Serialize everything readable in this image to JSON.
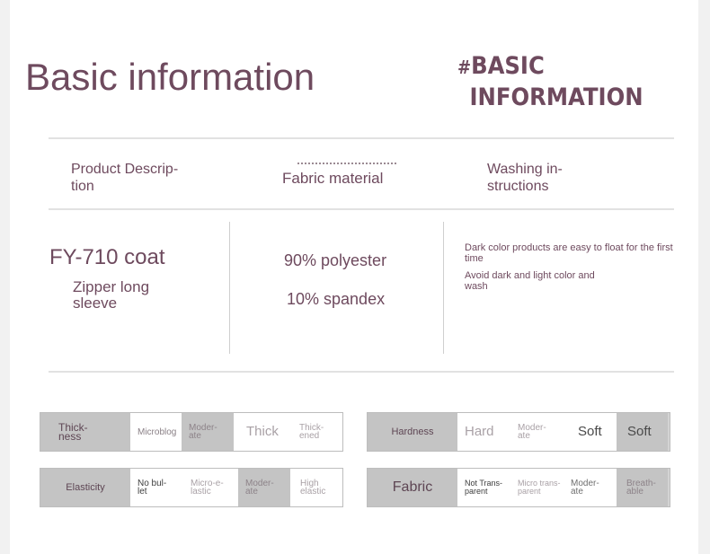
{
  "titles": {
    "left": "Basic information",
    "right_hash": "#",
    "right_line1": "BASIC",
    "right_line2": "INFORMATION"
  },
  "headers": {
    "product": [
      "Product Descrip-",
      "tion"
    ],
    "fabric": "Fabric material",
    "washing": [
      "Washing in-",
      "structions"
    ]
  },
  "product": {
    "model": "FY-710 coat",
    "desc": [
      "Zipper long",
      "sleeve"
    ]
  },
  "fabric": {
    "line1": "90% polyester",
    "line2": "10% spandex"
  },
  "washing": {
    "line1": [
      "Dark color products are easy to float for the first",
      "time"
    ],
    "line2": [
      "Avoid dark and light color and",
      "wash"
    ]
  },
  "attributes": {
    "thickness": {
      "label": [
        "Thick-",
        "ness"
      ],
      "options": [
        [
          "Microblog"
        ],
        [
          "Moder-",
          "ate"
        ],
        [
          "Thick"
        ],
        [
          "Thick-",
          "ened"
        ]
      ],
      "selected_index": 1
    },
    "hardness": {
      "label": [
        "Hardness"
      ],
      "options": [
        [
          "Hard"
        ],
        [
          "Moder-",
          "ate"
        ],
        [
          "Soft"
        ],
        [
          "Soft"
        ]
      ],
      "selected_index": 3
    },
    "elasticity": {
      "label": [
        "Elasticity"
      ],
      "options": [
        [
          "No bul-",
          "let"
        ],
        [
          "Micro-e-",
          "lastic"
        ],
        [
          "Moder-",
          "ate"
        ],
        [
          "High",
          "elastic"
        ]
      ],
      "selected_index": 2
    },
    "fabric": {
      "label": [
        "Fabric"
      ],
      "options": [
        [
          "Not Trans-",
          "parent"
        ],
        [
          "Micro trans-",
          "parent"
        ],
        [
          "Moder-",
          "ate"
        ],
        [
          "Breath-",
          "able"
        ]
      ],
      "selected_index": 3
    }
  },
  "colors": {
    "text_accent": "#6e4a5e",
    "selected_bg": "#c4c4c4",
    "divider": "#e2e2e2"
  }
}
